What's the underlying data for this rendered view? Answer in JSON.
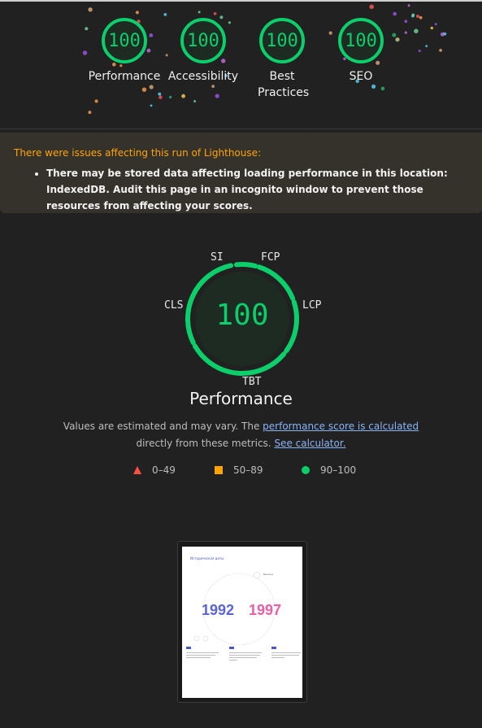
{
  "scores": [
    {
      "value": "100",
      "label": "Performance"
    },
    {
      "value": "100",
      "label": "Accessibility"
    },
    {
      "value": "100",
      "label": "Best Practices"
    },
    {
      "value": "100",
      "label": "SEO"
    }
  ],
  "warning": {
    "title": "There were issues affecting this run of Lighthouse:",
    "items": [
      "There may be stored data affecting loading performance in this location: IndexedDB. Audit this page in an incognito window to prevent those resources from affecting your scores."
    ]
  },
  "performance": {
    "score": "100",
    "title": "Performance",
    "metrics": {
      "si": "SI",
      "fcp": "FCP",
      "lcp": "LCP",
      "tbt": "TBT",
      "cls": "CLS"
    },
    "description_prefix": "Values are estimated and may vary. The ",
    "description_link": "performance score is calculated",
    "description_middle": "directly from these metrics. ",
    "calculator_link": "See calculator."
  },
  "legend": [
    {
      "range": "0–49",
      "color": "#ff4e42",
      "shape": "triangle-icon"
    },
    {
      "range": "50–89",
      "color": "#ffa400",
      "shape": "square-icon"
    },
    {
      "range": "90–100",
      "color": "#0cce6b",
      "shape": "circle-icon"
    }
  ],
  "thumbnail": {
    "heading": "Историческая даты",
    "year_left": "1992",
    "year_right": "1997",
    "small_label": "Былина"
  },
  "colors": {
    "pass": "#0cce6b",
    "average": "#ffa400",
    "fail": "#ff4e42",
    "link": "#8ab4f8"
  }
}
